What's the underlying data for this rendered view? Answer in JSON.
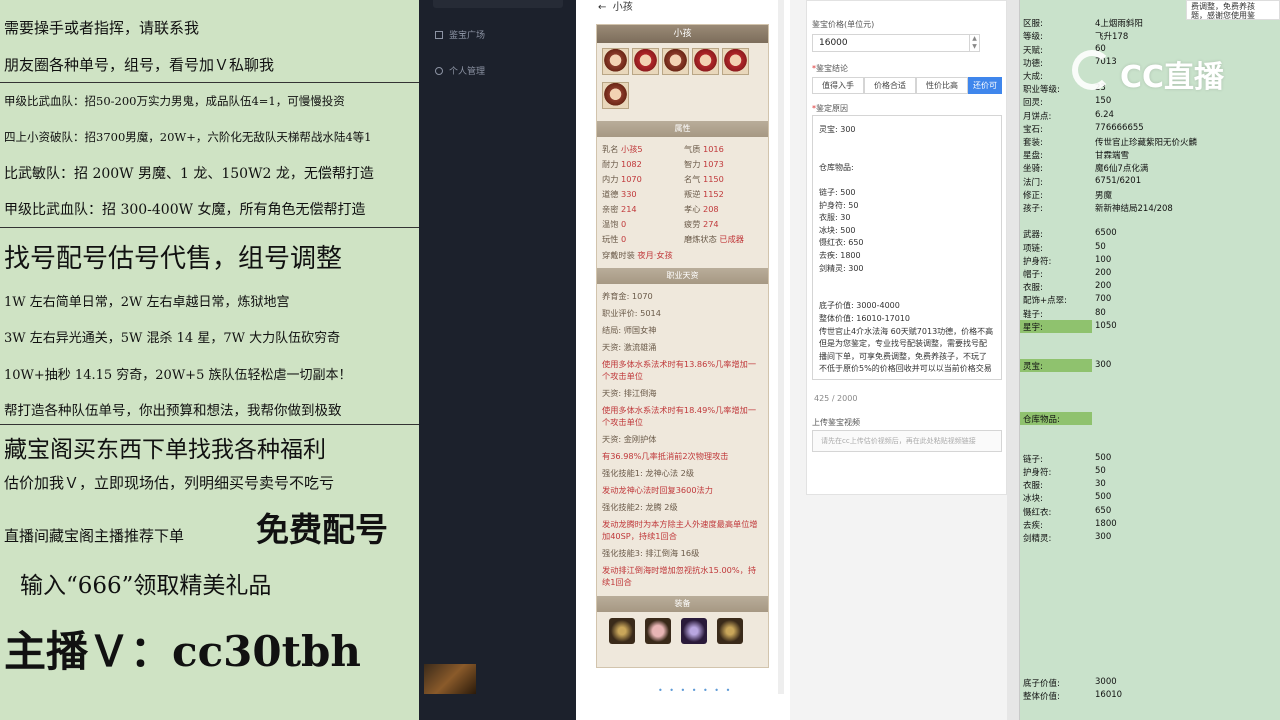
{
  "left_banner": {
    "lines": [
      "需要操手或者指挥，请联系我",
      "朋友圈各种单号，组号，看号加Ｖ私聊我",
      "甲级比武血队：招50-200万实力男鬼，成品队伍4=1，可慢慢投资",
      "四上小资破队：招3700男魔，20W+，六阶化无敌队天梯帮战水陆4等1",
      "比武敏队：招 200W 男魔、1 龙、150W2 龙，无偿帮打造",
      "甲级比武血队：招 300-400W 女魔，所有角色无偿帮打造",
      "找号配号估号代售，组号调整",
      "1W 左右简单日常，2W 左右卓越日常，炼狱地宫",
      "3W 左右异光通关，5W 混杀 14 星，7W 大力队伍砍穷奇",
      "10W+抽秒 14.15 穷奇，20W+5 族队伍轻松虐一切副本！",
      "帮打造各种队伍单号，你出预算和想法，我帮你做到极致",
      "藏宝阁买东西下单找我各种福利",
      "估价加我Ｖ，立即现场估，列明细买号卖号不吃亏",
      "直播间藏宝阁主播推荐下单",
      "免费配号",
      "输入“666”领取精美礼品",
      "主播Ｖ：cc30tbh"
    ]
  },
  "nav": {
    "items": [
      "鉴宝广场",
      "个人管理"
    ]
  },
  "phone": {
    "back_label": "小孩",
    "card_title": "小孩",
    "section_attr": "属性",
    "attrs": [
      {
        "k": "乳名",
        "v": "小孩5"
      },
      {
        "k": "气质",
        "v": "1016"
      },
      {
        "k": "耐力",
        "v": "1082"
      },
      {
        "k": "智力",
        "v": "1073"
      },
      {
        "k": "内力",
        "v": "1070"
      },
      {
        "k": "名气",
        "v": "1150"
      },
      {
        "k": "道德",
        "v": "330"
      },
      {
        "k": "叛逆",
        "v": "1152"
      },
      {
        "k": "亲密",
        "v": "214"
      },
      {
        "k": "孝心",
        "v": "208"
      },
      {
        "k": "温饱",
        "v": "0"
      },
      {
        "k": "疲劳",
        "v": "274"
      },
      {
        "k": "玩性",
        "v": "0"
      },
      {
        "k": "磨炼状态",
        "v": "已成器"
      }
    ],
    "wear": {
      "k": "穿戴时装",
      "v": "夜月·女孩"
    },
    "section_career": "职业天资",
    "career_lines": [
      {
        "text": "养育金: 1070",
        "red": false
      },
      {
        "text": "职业评价: 5014",
        "red": false
      },
      {
        "text": "结局: 师国女神",
        "red": false
      },
      {
        "text": "天资: 激流雄涌",
        "red": false
      },
      {
        "text": "使用多体水系法术时有13.86%几率增加一个攻击单位",
        "red": true
      },
      {
        "text": "天资: 排江倒海",
        "red": false
      },
      {
        "text": "使用多体水系法术时有18.49%几率增加一个攻击单位",
        "red": true
      },
      {
        "text": "天资: 金刚护体",
        "red": false
      },
      {
        "text": "有36.98%几率抵消前2次物理攻击",
        "red": true
      },
      {
        "text": "强化技能1: 龙神心法 2级",
        "red": false
      },
      {
        "text": "发动龙神心法时回复3600法力",
        "red": true
      },
      {
        "text": "强化技能2: 龙腾 2级",
        "red": false
      },
      {
        "text": "发动龙腾时为本方除主人外速度最高单位增加40SP，持续1回合",
        "red": true
      },
      {
        "text": "强化技能3: 排江倒海 16级",
        "red": false
      },
      {
        "text": "发动排江倒海时增加忽视抗水15.00%，持续1回合",
        "red": true
      }
    ],
    "section_equip": "装备",
    "pager": "• • • • • • •"
  },
  "form": {
    "price_label": "鉴宝价格(单位元)",
    "price_value": "16000",
    "conclusion_label": "鉴宝结论",
    "buttons": [
      "值得入手",
      "价格合适",
      "性价比高",
      "还价可"
    ],
    "active_button": 3,
    "reason_label": "鉴定原因",
    "reason_lines": [
      "灵宝:     300",
      "",
      "",
      "仓库物品:",
      "",
      "链子:        500",
      "护身符:    50",
      "衣服:        30",
      "冰块:        500",
      "慑红衣:    650",
      "去疾:        1800",
      "剑精灵:    300",
      "",
      "",
      "底子价值:        3000-4000",
      "整体价值:        16010-17010",
      "传世官止4介水法海 60天赋7013功德，价格不高",
      "但是为您鉴定，专业找号配装调整，需要找号配",
      "播间下单，可享免费调整，免费养孩子，不玩了",
      "不低于原价5%的价格回收并可以以当前价格交易"
    ],
    "char_count": "425 / 2000",
    "upload_label": "上传鉴宝视频",
    "upload_hint": "请先在cc上传估价视频后，再在此处粘贴视频链接"
  },
  "sheet": {
    "rows": [
      {
        "k": "区服:",
        "v": "4上烟雨斜阳"
      },
      {
        "k": "等级:",
        "v": "飞升178"
      },
      {
        "k": "天赋:",
        "v": "60"
      },
      {
        "k": "功德:",
        "v": "7013"
      },
      {
        "k": "大成:",
        "v": ""
      },
      {
        "k": "职业等级:",
        "v": "23"
      },
      {
        "k": "回灵:",
        "v": "150"
      },
      {
        "k": "月饼点:",
        "v": "6.24"
      },
      {
        "k": "宝石:",
        "v": "776666655"
      },
      {
        "k": "套装:",
        "v": "传世官止珍藏紫阳无价火麟"
      },
      {
        "k": "星盘:",
        "v": "甘霖端雪"
      },
      {
        "k": "坐骑:",
        "v": "魔6仙7点化满"
      },
      {
        "k": "法门:",
        "v": "6751/6201"
      },
      {
        "k": "修正:",
        "v": "男魔"
      },
      {
        "k": "孩子:",
        "v": "新新神结局214/208"
      },
      {
        "k": "武器:",
        "v": "6500"
      },
      {
        "k": "项链:",
        "v": "50"
      },
      {
        "k": "护身符:",
        "v": "100"
      },
      {
        "k": "帽子:",
        "v": "200"
      },
      {
        "k": "衣服:",
        "v": "200"
      },
      {
        "k": "配饰+点翠:",
        "v": "700"
      },
      {
        "k": "鞋子:",
        "v": "80"
      },
      {
        "k": "星宇:",
        "v": "1050"
      },
      {
        "k": "灵宝:",
        "v": "300"
      },
      {
        "k": "仓库物品:",
        "v": ""
      },
      {
        "k": "链子:",
        "v": "500"
      },
      {
        "k": "护身符:",
        "v": "50"
      },
      {
        "k": "衣服:",
        "v": "30"
      },
      {
        "k": "冰块:",
        "v": "500"
      },
      {
        "k": "慑红衣:",
        "v": "650"
      },
      {
        "k": "去疾:",
        "v": "1800"
      },
      {
        "k": "剑精灵:",
        "v": "300"
      },
      {
        "k": "底子价值:",
        "v": "3000"
      },
      {
        "k": "整体价值:",
        "v": "16010"
      }
    ]
  },
  "watermark": {
    "text": "CC直播"
  },
  "tooltip": {
    "line1": "费调整，免费养孩",
    "line2": "题，感谢您使用鉴"
  },
  "colors": {
    "accent": "#3f86ec",
    "sheet_green": "#c9e2cb",
    "highlight": "#8fc26e",
    "red_value": "#c0393b"
  }
}
